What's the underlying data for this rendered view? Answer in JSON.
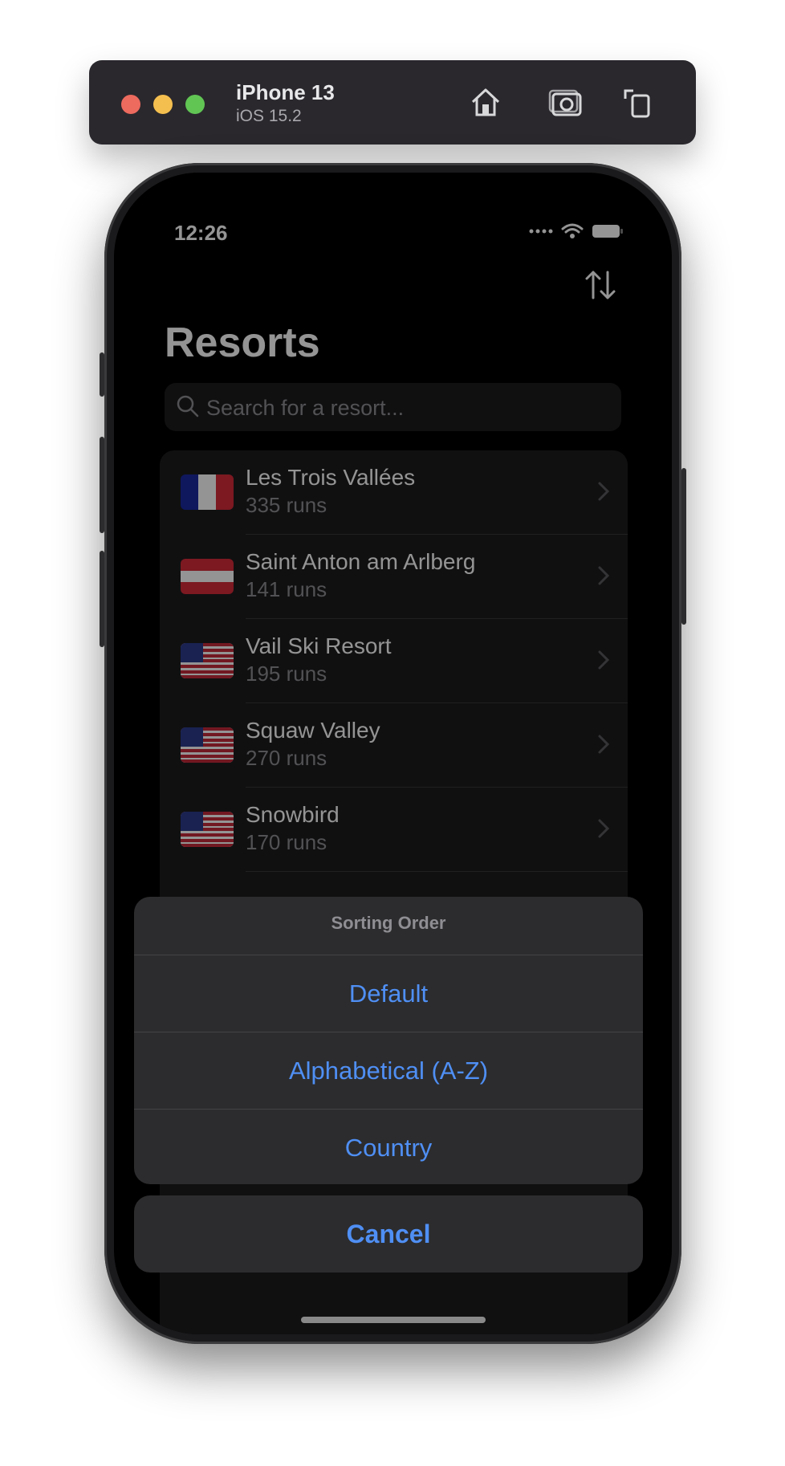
{
  "simulator": {
    "device": "iPhone 13",
    "os": "iOS 15.2",
    "icons": [
      "home-icon",
      "screenshot-icon",
      "rotate-icon"
    ]
  },
  "status_bar": {
    "time": "12:26"
  },
  "nav": {
    "title": "Resorts",
    "search_placeholder": "Search for a resort...",
    "sort_icon": "sort-arrows-icon"
  },
  "resorts": [
    {
      "name": "Les Trois Vallées",
      "runs": "335 runs",
      "flag": "france"
    },
    {
      "name": "Saint Anton am Arlberg",
      "runs": "141 runs",
      "flag": "austria"
    },
    {
      "name": "Vail Ski Resort",
      "runs": "195 runs",
      "flag": "usa"
    },
    {
      "name": "Squaw Valley",
      "runs": "270 runs",
      "flag": "usa"
    },
    {
      "name": "Snowbird",
      "runs": "170 runs",
      "flag": "usa"
    }
  ],
  "action_sheet": {
    "title": "Sorting Order",
    "options": [
      "Default",
      "Alphabetical (A-Z)",
      "Country"
    ],
    "cancel": "Cancel"
  },
  "colors": {
    "accent": "#4f8ff4",
    "background": "#000000",
    "cell": "#1c1c1e",
    "sheet": "#2c2c2e"
  }
}
